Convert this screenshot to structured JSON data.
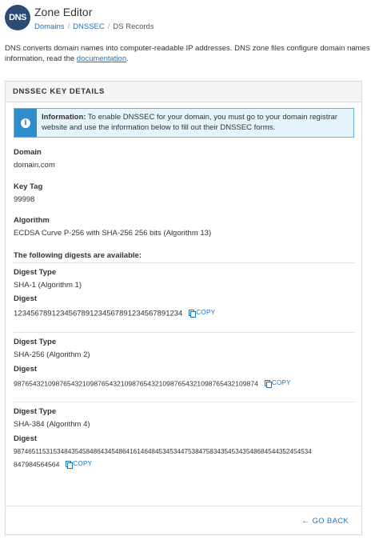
{
  "header": {
    "logo_text": "DNS",
    "title": "Zone Editor",
    "breadcrumbs": [
      {
        "label": "Domains"
      },
      {
        "label": "DNSSEC"
      },
      {
        "label": "DS Records"
      }
    ],
    "separator": "/"
  },
  "intro": {
    "line1": "DNS converts domain names into computer-readable IP addresses. DNS zone files configure domain names",
    "line2_prefix": "information, read the ",
    "link": "documentation",
    "line2_suffix": "."
  },
  "panel": {
    "title": "DNSSEC KEY DETAILS",
    "info": {
      "icon": "info-circle-icon",
      "label": "Information:",
      "text": " To enable DNSSEC for your domain, you must go to your domain registrar website and use the information below to fill out their DNSSEC forms."
    },
    "domain_label": "Domain",
    "domain_value": "domain.com",
    "keytag_label": "Key Tag",
    "keytag_value": "99998",
    "algorithm_label": "Algorithm",
    "algorithm_value": "ECDSA Curve P-256 with SHA-256 256 bits (Algorithm 13)",
    "digests_heading": "The following digests are available:",
    "digests": [
      {
        "type_label": "Digest Type",
        "type_value": "SHA-1 (Algorithm 1)",
        "digest_label": "Digest",
        "digest_value": "1234567891234567891234567891234567891234",
        "copy_label": "COPY"
      },
      {
        "type_label": "Digest Type",
        "type_value": "SHA-256 (Algorithm 2)",
        "digest_label": "Digest",
        "digest_value": "9876543210987654321098765432109876543210987654321098765432109874",
        "copy_label": "COPY"
      },
      {
        "type_label": "Digest Type",
        "type_value": "SHA-384 (Algorithm 4)",
        "digest_label": "Digest",
        "digest_value_line1": "987465115315348435458486434548641614648453453447538475834354534354868454435245453​4",
        "digest_value_line2": "847984564564",
        "copy_label": "COPY"
      }
    ],
    "go_back_label": "GO BACK"
  },
  "colors": {
    "link": "#1a74c0",
    "logo_bg": "#2b4a74",
    "info_bg": "#e5f3fa",
    "info_border": "#5fb4de",
    "info_icon_bg": "#2f8dcc"
  }
}
